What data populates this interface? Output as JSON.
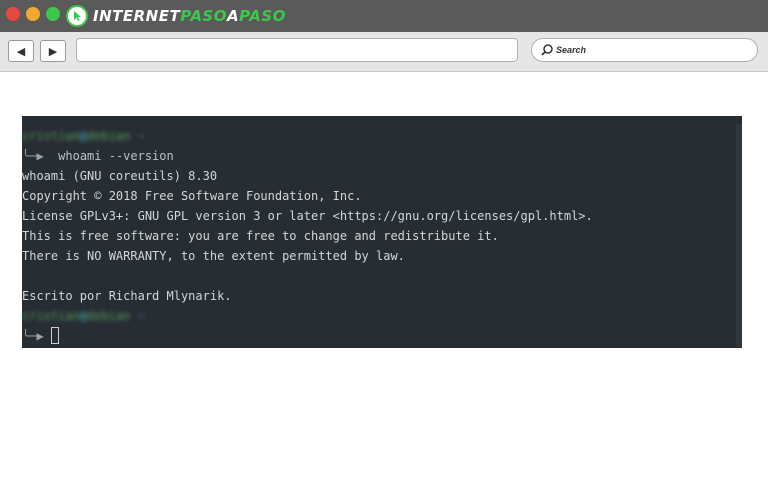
{
  "browser": {
    "logo": {
      "part1": "INTERNET",
      "part2": "PASO",
      "part3": "A",
      "part4": "PASO"
    },
    "nav": {
      "back_glyph": "◀",
      "forward_glyph": "▶"
    },
    "url_value": "",
    "search_placeholder": "Search",
    "colors": {
      "frame": "#5a5a5a",
      "toolbar": "#e6e6e6",
      "close": "#e8483f",
      "minimize": "#f0a830",
      "maximize": "#3cc84a",
      "brand_green": "#3cc84a"
    }
  },
  "terminal": {
    "background": "#262d33",
    "prompt1": {
      "user": "cristian",
      "at": "@",
      "host": "debian",
      "tail": " ~"
    },
    "arrow": "╰─▶",
    "command": "whoami --version",
    "output": [
      "whoami (GNU coreutils) 8.30",
      "Copyright © 2018 Free Software Foundation, Inc.",
      "License GPLv3+: GNU GPL version 3 or later <https://gnu.org/licenses/gpl.html>.",
      "This is free software: you are free to change and redistribute it.",
      "There is NO WARRANTY, to the extent permitted by law.",
      "",
      "Escrito por Richard Mlynarik."
    ],
    "prompt2": {
      "user": "cristian",
      "at": "@",
      "host": "debian",
      "tail": " ~"
    }
  }
}
